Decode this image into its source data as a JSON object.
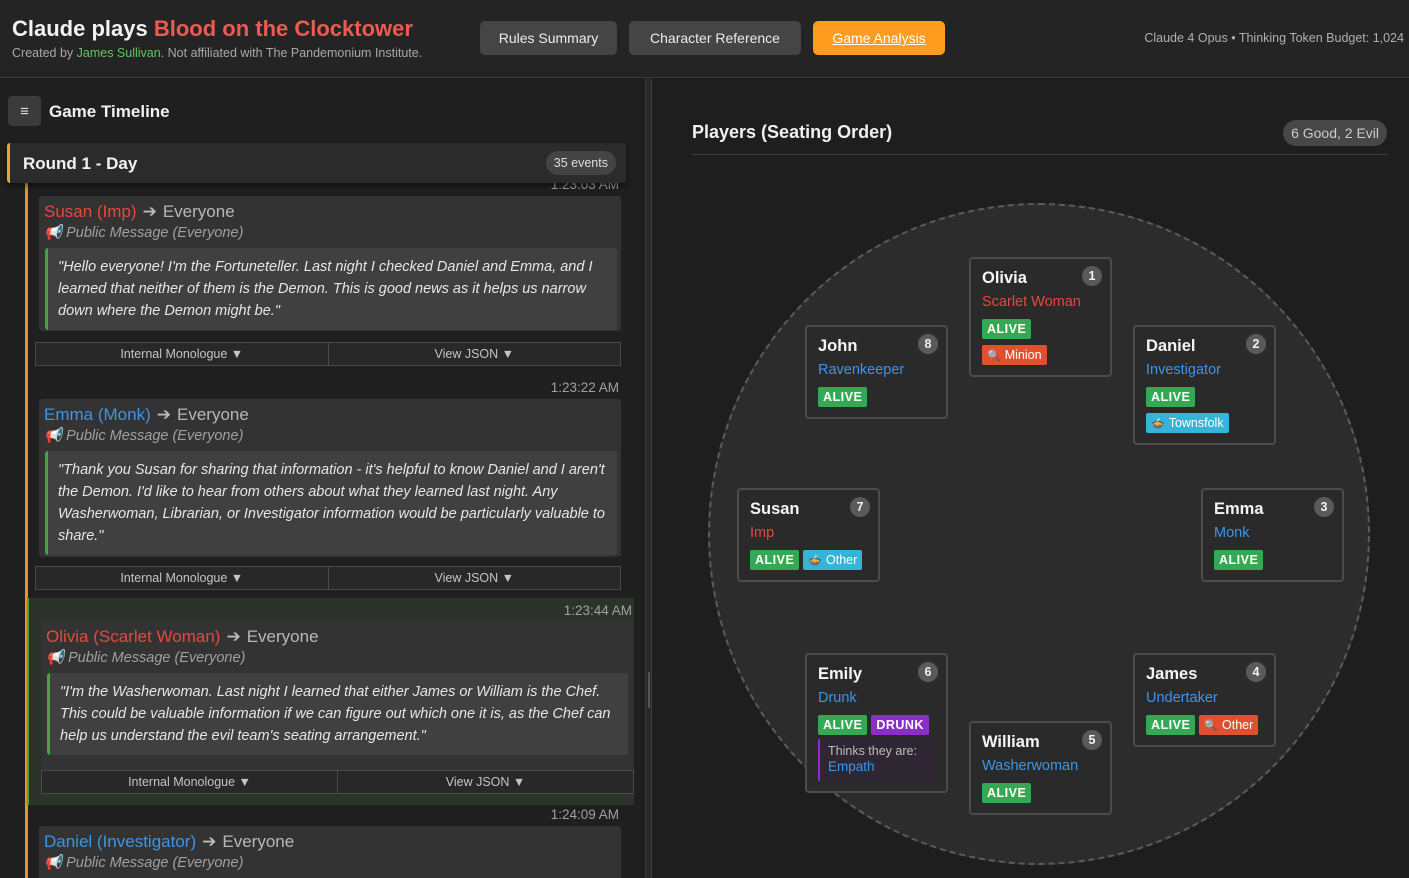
{
  "header": {
    "title_prefix": "Claude plays ",
    "title_accent": "Blood on the Clocktower",
    "subtitle_prefix": "Created by ",
    "subtitle_author": "James Sullivan",
    "subtitle_suffix": ". Not affiliated with The Pandemonium Institute.",
    "buttons": {
      "rules": "Rules Summary",
      "characters": "Character Reference",
      "analysis": "Game Analysis"
    },
    "model_info": "Claude 4 Opus • Thinking Token Budget: 1,024"
  },
  "timeline": {
    "menu_icon": "≡",
    "title": "Game Timeline",
    "round_title": "Round 1 - Day",
    "events_count": "35 events",
    "events": [
      {
        "timestamp": "1:23:03 AM",
        "speaker": "Susan (Imp)",
        "target": "Everyone",
        "type": "Public Message (Everyone)",
        "message": "\"Hello everyone! I'm the Fortuneteller. Last night I checked Daniel and Emma, and I learned that neither of them is the Demon. This is good news as it helps us narrow down where the Demon might be.\"",
        "monologue_label": "Internal Monologue ▼",
        "json_label": "View JSON ▼"
      },
      {
        "timestamp": "1:23:22 AM",
        "speaker": "Emma (Monk)",
        "target": "Everyone",
        "type": "Public Message (Everyone)",
        "message": "\"Thank you Susan for sharing that information - it's helpful to know Daniel and I aren't the Demon. I'd like to hear from others about what they learned last night. Any Washerwoman, Librarian, or Investigator information would be particularly valuable to share.\"",
        "monologue_label": "Internal Monologue ▼",
        "json_label": "View JSON ▼"
      },
      {
        "timestamp": "1:23:44 AM",
        "speaker": "Olivia (Scarlet Woman)",
        "target": "Everyone",
        "type": "Public Message (Everyone)",
        "message": "\"I'm the Washerwoman. Last night I learned that either James or William is the Chef. This could be valuable information if we can figure out which one it is, as the Chef can help us understand the evil team's seating arrangement.\"",
        "monologue_label": "Internal Monologue ▼",
        "json_label": "View JSON ▼"
      },
      {
        "timestamp": "1:24:09 AM",
        "speaker": "Daniel (Investigator)",
        "target": "Everyone",
        "type": "Public Message (Everyone)"
      }
    ]
  },
  "players": {
    "title": "Players (Seating Order)",
    "summary": "6 Good, 2 Evil",
    "alive_label": "ALIVE",
    "list": [
      {
        "seat": "1",
        "name": "Olivia",
        "role": "Scarlet Woman",
        "tag": "Minion",
        "tag_icon": "magnifier-icon"
      },
      {
        "seat": "2",
        "name": "Daniel",
        "role": "Investigator",
        "tag": "Townsfolk",
        "tag_icon": "cauldron-icon"
      },
      {
        "seat": "3",
        "name": "Emma",
        "role": "Monk"
      },
      {
        "seat": "4",
        "name": "James",
        "role": "Undertaker",
        "tag": "Other",
        "tag_icon": "magnifier-icon"
      },
      {
        "seat": "5",
        "name": "William",
        "role": "Washerwoman"
      },
      {
        "seat": "6",
        "name": "Emily",
        "role": "Drunk",
        "status2": "DRUNK",
        "thinks_label": "Thinks they are:",
        "thinks_value": "Empath"
      },
      {
        "seat": "7",
        "name": "Susan",
        "role": "Imp",
        "tag": "Other",
        "tag_icon": "cauldron-icon"
      },
      {
        "seat": "8",
        "name": "John",
        "role": "Ravenkeeper"
      }
    ]
  },
  "colors": {
    "evil": "#e9473d",
    "good": "#3b95e8",
    "alive": "#34a853",
    "accent": "#ff9b1f"
  }
}
